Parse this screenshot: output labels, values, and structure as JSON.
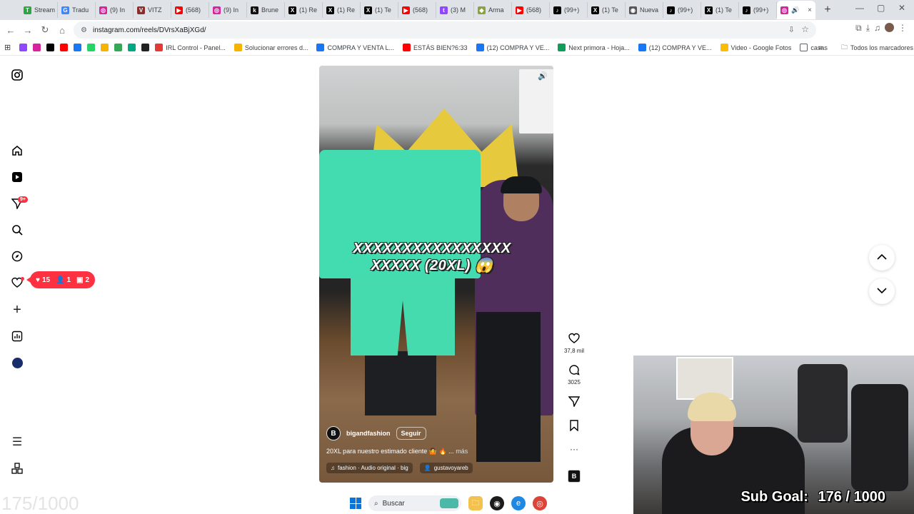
{
  "browser": {
    "tabs": [
      {
        "label": "Stream",
        "color": "#2ba640",
        "glyph": "T"
      },
      {
        "label": "Tradu",
        "color": "#4285f4",
        "glyph": "G"
      },
      {
        "label": "(9) In",
        "color": "#d6249f",
        "glyph": "◎"
      },
      {
        "label": "VITZ",
        "color": "#8b2d2d",
        "glyph": "V"
      },
      {
        "label": "(568)",
        "color": "#ff0000",
        "glyph": "▶"
      },
      {
        "label": "(9) In",
        "color": "#d6249f",
        "glyph": "◎"
      },
      {
        "label": "Brune",
        "color": "#111111",
        "glyph": "k"
      },
      {
        "label": "(1) Re",
        "color": "#000000",
        "glyph": "X"
      },
      {
        "label": "(1) Re",
        "color": "#000000",
        "glyph": "X"
      },
      {
        "label": "(1) Te",
        "color": "#000000",
        "glyph": "X"
      },
      {
        "label": "(568)",
        "color": "#ff0000",
        "glyph": "▶"
      },
      {
        "label": "(3) M",
        "color": "#9146ff",
        "glyph": "t"
      },
      {
        "label": "Arma",
        "color": "#8aa33a",
        "glyph": "◆"
      },
      {
        "label": "(568)",
        "color": "#ff0000",
        "glyph": "▶"
      },
      {
        "label": "(99+)",
        "color": "#000000",
        "glyph": "♪"
      },
      {
        "label": "(1) Te",
        "color": "#000000",
        "glyph": "X"
      },
      {
        "label": "Nueva",
        "color": "#555555",
        "glyph": "◉"
      },
      {
        "label": "(99+)",
        "color": "#000000",
        "glyph": "♪"
      },
      {
        "label": "(1) Te",
        "color": "#000000",
        "glyph": "X"
      },
      {
        "label": "(99+)",
        "color": "#000000",
        "glyph": "♪"
      }
    ],
    "active_tab": {
      "color": "#d6249f",
      "glyph": "◎",
      "close": "×"
    },
    "new_tab": "+",
    "url": "instagram.com/reels/DVrsXaBjXGd/",
    "bookmarks": [
      {
        "label": "",
        "color": "#9146ff"
      },
      {
        "label": "",
        "color": "#d6249f"
      },
      {
        "label": "",
        "color": "#000000"
      },
      {
        "label": "",
        "color": "#ff0000"
      },
      {
        "label": "",
        "color": "#1877f2"
      },
      {
        "label": "",
        "color": "#25d366"
      },
      {
        "label": "",
        "color": "#f4b400"
      },
      {
        "label": "",
        "color": "#34a853"
      },
      {
        "label": "",
        "color": "#00a884"
      },
      {
        "label": "",
        "color": "#222222"
      },
      {
        "label": "IRL Control - Panel...",
        "color": "#e53935"
      },
      {
        "label": "Solucionar errores d...",
        "color": "#f4b400"
      },
      {
        "label": "COMPRA Y VENTA L...",
        "color": "#1877f2"
      },
      {
        "label": "ESTÁS BIEN?6:33",
        "color": "#ff0000"
      },
      {
        "label": "(12) COMPRA Y VE...",
        "color": "#1877f2"
      },
      {
        "label": "Next primora - Hoja...",
        "color": "#0f9d58"
      },
      {
        "label": "(12) COMPRA Y VE...",
        "color": "#1877f2"
      },
      {
        "label": "Video - Google Fotos",
        "color": "#fbbc04"
      },
      {
        "label": "casas",
        "color": "#ffffff"
      }
    ],
    "all_bookmarks": "Todos los marcadores",
    "overflow": "»"
  },
  "instagram": {
    "notifications_badge": "9+",
    "activity_pill": {
      "likes": "15",
      "follows": "1",
      "comments": "2"
    },
    "reel": {
      "overlay_line1": "XXXXXXXXXXXXXXXX",
      "overlay_line2": "XXXXX (20XL) 😱",
      "username": "bigandfashion",
      "follow_label": "Seguir",
      "caption": "20XL para nuestro estimado cliente 🤷 🔥 ...",
      "caption_more": "más",
      "audio": "fashion · Audio original · big",
      "tagged_user": "gustavoyareb",
      "avatar_letter": "B"
    },
    "actions": {
      "likes": "37,8 mil",
      "comments": "3025",
      "more": "···"
    }
  },
  "stream": {
    "ghost_counter": "175/1000",
    "sub_goal_label": "Sub Goal:",
    "sub_goal_value": "176 / 1000"
  },
  "taskbar": {
    "search_placeholder": "Buscar"
  }
}
